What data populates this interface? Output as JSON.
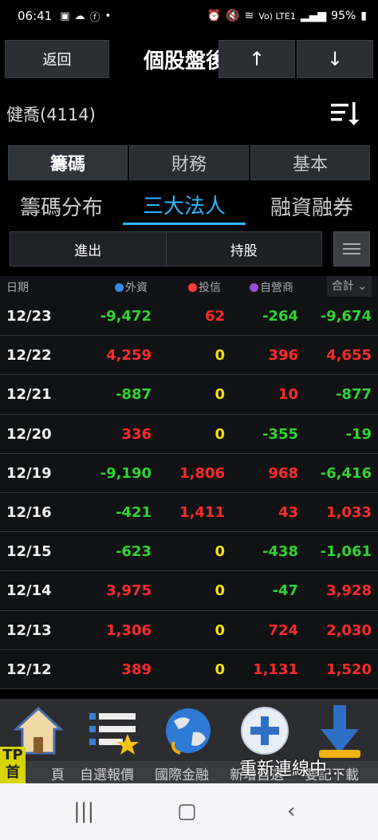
{
  "status": {
    "time": "06:41",
    "battery": "95%",
    "net": "Vo) LTE1"
  },
  "header": {
    "back_label": "返回",
    "title": "個股盤後",
    "up_label": "↑",
    "down_label": "↓"
  },
  "stock": {
    "name": "健喬(4114)"
  },
  "main_tabs": [
    "籌碼",
    "財務",
    "基本"
  ],
  "sub_tabs": [
    "籌碼分布",
    "三大法人",
    "融資融券"
  ],
  "toggles": [
    "進出",
    "持股"
  ],
  "table": {
    "headers": {
      "date": "日期",
      "foreign": "外資",
      "trust": "投信",
      "dealer": "自營商",
      "total": "合計"
    },
    "colors": {
      "foreign": "#2e8de6",
      "trust": "#ff3b3b",
      "dealer": "#9a4fd6"
    },
    "rows": [
      {
        "date": "12/23",
        "foreign": "-9,472",
        "trust": "62",
        "dealer": "-264",
        "total": "-9,674"
      },
      {
        "date": "12/22",
        "foreign": "4,259",
        "trust": "0",
        "dealer": "396",
        "total": "4,655"
      },
      {
        "date": "12/21",
        "foreign": "-887",
        "trust": "0",
        "dealer": "10",
        "total": "-877"
      },
      {
        "date": "12/20",
        "foreign": "336",
        "trust": "0",
        "dealer": "-355",
        "total": "-19"
      },
      {
        "date": "12/19",
        "foreign": "-9,190",
        "trust": "1,806",
        "dealer": "968",
        "total": "-6,416"
      },
      {
        "date": "12/16",
        "foreign": "-421",
        "trust": "1,411",
        "dealer": "43",
        "total": "1,033"
      },
      {
        "date": "12/15",
        "foreign": "-623",
        "trust": "0",
        "dealer": "-438",
        "total": "-1,061"
      },
      {
        "date": "12/14",
        "foreign": "3,975",
        "trust": "0",
        "dealer": "-47",
        "total": "3,928"
      },
      {
        "date": "12/13",
        "foreign": "1,306",
        "trust": "0",
        "dealer": "724",
        "total": "2,030"
      },
      {
        "date": "12/12",
        "foreign": "389",
        "trust": "0",
        "dealer": "1,131",
        "total": "1,520"
      }
    ]
  },
  "bottom_nav": {
    "labels": [
      "頁",
      "自選報價",
      "國際金融",
      "新增自選",
      "要記下載"
    ],
    "tp_badge": "TP\n首",
    "reconnect": "重新連線中..."
  }
}
